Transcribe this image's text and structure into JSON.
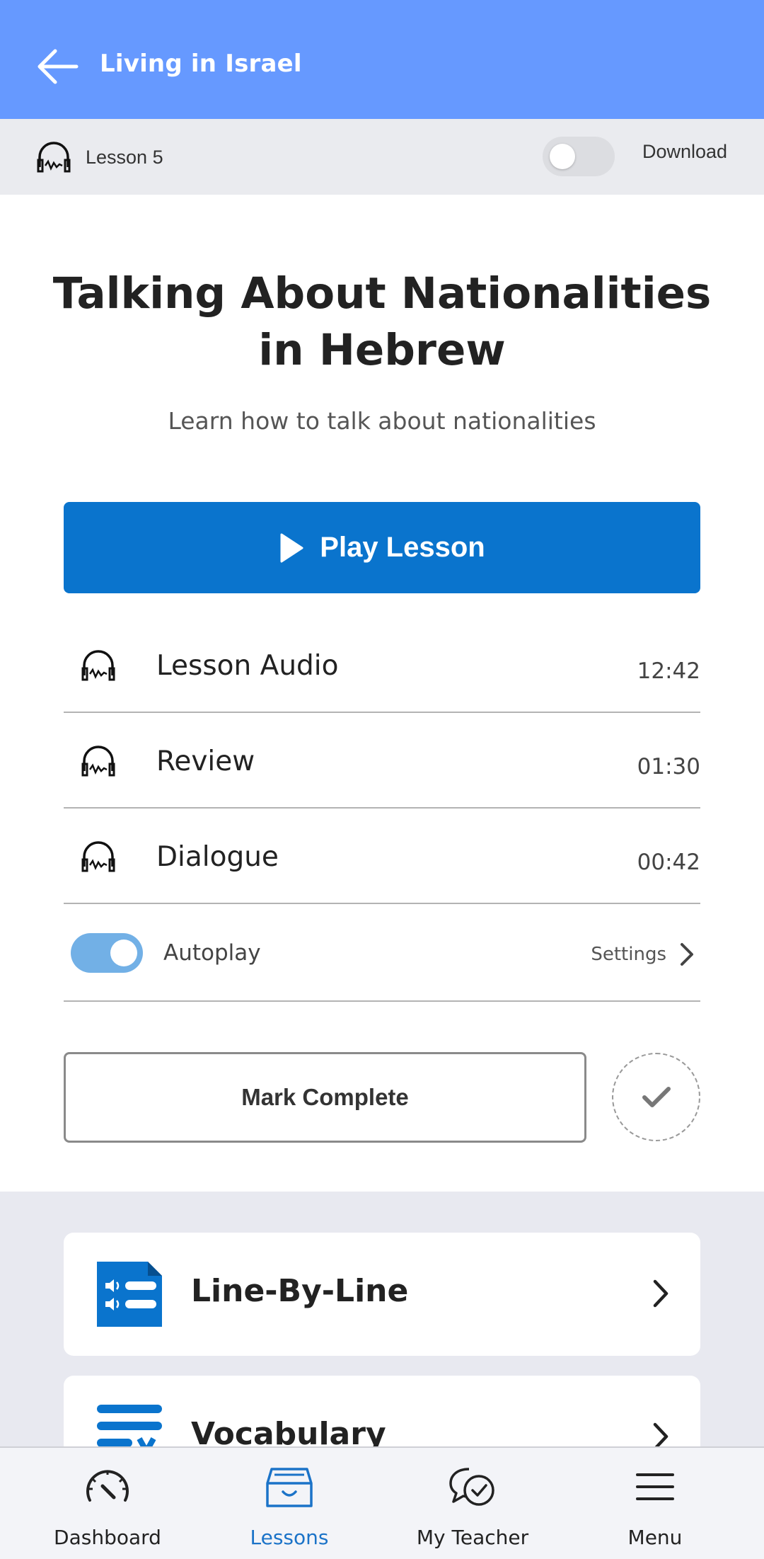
{
  "header": {
    "title": "Living in Israel"
  },
  "lesson_bar": {
    "lesson_label": "Lesson 5",
    "download_label": "Download",
    "download_enabled": false
  },
  "lesson": {
    "title": "Talking About Nationalities in Hebrew",
    "subtitle": "Learn how to talk about nationalities",
    "play_label": "Play Lesson"
  },
  "tracks": [
    {
      "name": "Lesson Audio",
      "duration": "12:42"
    },
    {
      "name": "Review",
      "duration": "01:30"
    },
    {
      "name": "Dialogue",
      "duration": "00:42"
    }
  ],
  "autoplay": {
    "label": "Autoplay",
    "enabled": true,
    "settings_label": "Settings"
  },
  "mark_complete_label": "Mark Complete",
  "cards": [
    {
      "name": "Line-By-Line",
      "icon": "line-by-line-icon"
    },
    {
      "name": "Vocabulary",
      "icon": "vocabulary-icon"
    }
  ],
  "nav": [
    {
      "label": "Dashboard",
      "icon": "dashboard-icon",
      "active": false
    },
    {
      "label": "Lessons",
      "icon": "lessons-icon",
      "active": true
    },
    {
      "label": "My Teacher",
      "icon": "my-teacher-icon",
      "active": false
    },
    {
      "label": "Menu",
      "icon": "menu-icon",
      "active": false
    }
  ],
  "colors": {
    "header_bg": "#6699ff",
    "primary": "#0a74cd",
    "toggle_on": "#72b0e6",
    "nav_active": "#1b73c8"
  }
}
